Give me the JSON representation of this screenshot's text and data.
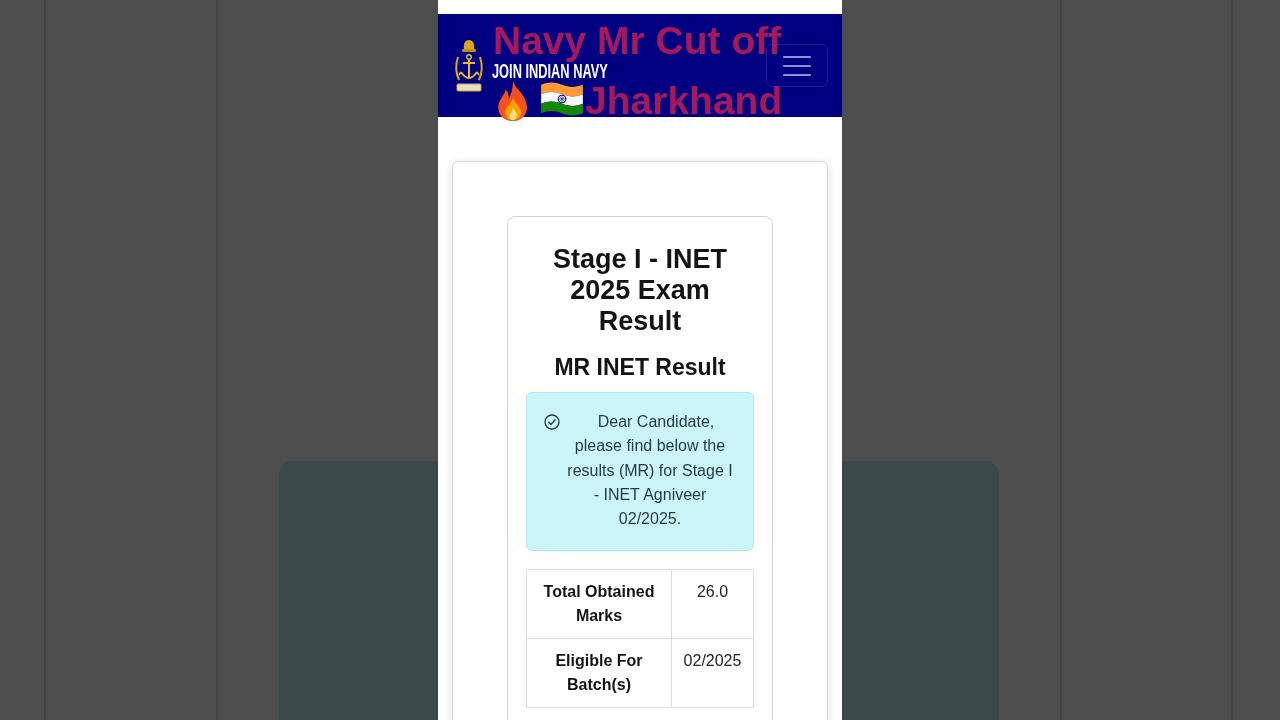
{
  "caption": {
    "line_1": "Navy Mr Cut off",
    "line_2": "Jharkhand"
  },
  "header": {
    "brand": "JOIN INDIAN NAVY"
  },
  "result_card": {
    "title": "Stage I - INET 2025 Exam Result",
    "subtitle": "MR INET Result",
    "notice": "Dear Candidate, please find below the results (MR) for Stage I - INET Agniveer 02/2025.",
    "table": {
      "rows": [
        {
          "label": "Total Obtained Marks",
          "value": "26.0"
        },
        {
          "label": "Eligible For Batch(s)",
          "value": "02/2025"
        }
      ]
    }
  }
}
